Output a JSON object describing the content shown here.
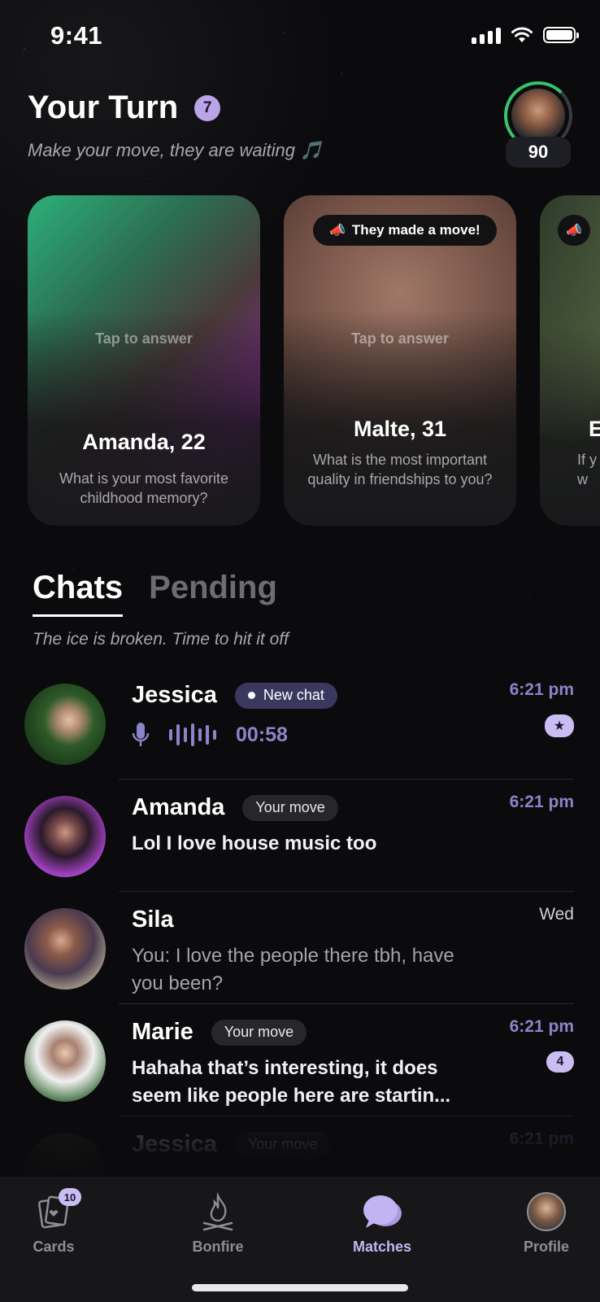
{
  "status_bar": {
    "time": "9:41"
  },
  "header": {
    "title": "Your Turn",
    "count": "7",
    "subtitle": "Make your move, they are waiting 🎵",
    "score": "90"
  },
  "cards": [
    {
      "tap_hint": "Tap to answer",
      "name": "Amanda, 22",
      "question": "What is your most favorite childhood memory?"
    },
    {
      "badge": "They made a move!",
      "tap_hint": "Tap to answer",
      "name": "Malte, 31",
      "question": "What is the most important quality in friendships to you?"
    },
    {
      "name": "E",
      "question": "If y hav w"
    }
  ],
  "tabs": {
    "chats": "Chats",
    "pending": "Pending",
    "subtitle": "The ice is broken. Time to hit it off"
  },
  "chats": [
    {
      "name": "Jessica",
      "status": "New chat",
      "time": "6:21 pm",
      "voice_duration": "00:58",
      "badge_icon": "star-icon"
    },
    {
      "name": "Amanda",
      "status": "Your move",
      "time": "6:21 pm",
      "message": "Lol I love house music too"
    },
    {
      "name": "Sila",
      "time": "Wed",
      "message": "You: I love the people there tbh, have you been?"
    },
    {
      "name": "Marie",
      "status": "Your move",
      "time": "6:21 pm",
      "message": "Hahaha that’s interesting, it does seem like people here are startin...",
      "unread": "4"
    },
    {
      "name": "Jessica",
      "status": "Your move",
      "time": "6:21 pm"
    }
  ],
  "tabbar": {
    "cards": "Cards",
    "cards_badge": "10",
    "bonfire": "Bonfire",
    "matches": "Matches",
    "profile": "Profile"
  },
  "colors": {
    "accent": "#8b84c8",
    "accent_light": "#c9bdf2",
    "ring": "#37c46a",
    "background": "#0b0b0d"
  }
}
